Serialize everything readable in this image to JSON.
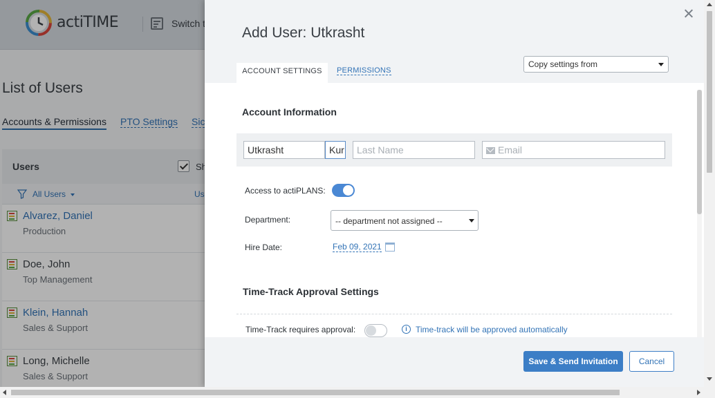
{
  "app": {
    "logo_text": "actiTIME",
    "switch_text": "Switch t"
  },
  "page": {
    "title": "List of Users",
    "tabs": [
      "Accounts & Permissions",
      "PTO Settings",
      "Sic"
    ]
  },
  "users_panel": {
    "title": "Users",
    "show_checkbox_label": "Sh",
    "show_checked": true,
    "filter_label": "All Users",
    "column_fragment": "Us",
    "users": [
      {
        "name": "Alvarez, Daniel",
        "department": "Production",
        "link": true
      },
      {
        "name": "Doe, John",
        "department": "Top Management",
        "link": false
      },
      {
        "name": "Klein, Hannah",
        "department": "Sales & Support",
        "link": true
      },
      {
        "name": "Long, Michelle",
        "department": "Sales & Support",
        "link": false
      }
    ]
  },
  "modal": {
    "title": "Add User: Utkrasht",
    "tabs": {
      "account": "ACCOUNT SETTINGS",
      "permissions": "PERMISSIONS"
    },
    "copy_settings": "Copy settings from",
    "account_info": {
      "section_title": "Account Information",
      "first_name": "Utkrasht",
      "middle_value": "Kur",
      "last_name_placeholder": "Last Name",
      "email_placeholder": "Email"
    },
    "access_label": "Access to actiPLANS:",
    "access_enabled": true,
    "department_label": "Department:",
    "department_value": "-- department not assigned --",
    "hire_date_label": "Hire Date:",
    "hire_date_value": "Feb 09, 2021",
    "approval": {
      "section_title": "Time-Track Approval Settings",
      "requires_label": "Time-Track requires approval:",
      "requires_enabled": false,
      "info_text": "Time-track will be approved automatically"
    },
    "buttons": {
      "save": "Save & Send Invitation",
      "cancel": "Cancel"
    }
  },
  "colors": {
    "accent": "#3c7ec6",
    "link": "#3273b6",
    "toggle_on": "#4a88d4"
  }
}
